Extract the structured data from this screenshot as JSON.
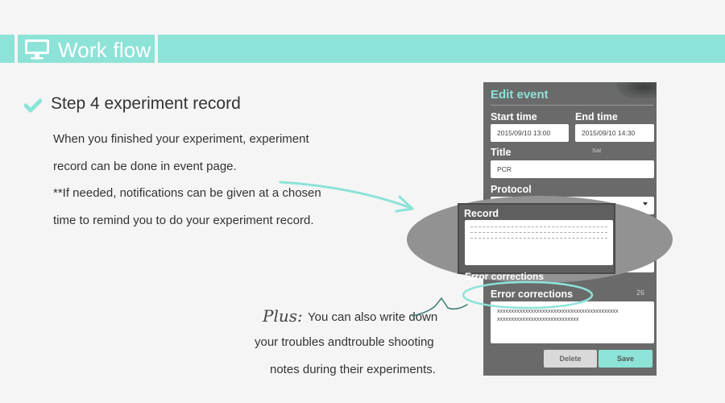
{
  "header": {
    "title": "Work flow",
    "icon": "monitor-icon",
    "color": "#8de3d8"
  },
  "step": {
    "icon": "check-icon",
    "title": "Step  4 experiment record",
    "lines": [
      "When you finished your experiment, experiment",
      "record can be done in event page.",
      "**If needed, notifications can be given at a chosen",
      "time to remind you to do your experiment record."
    ]
  },
  "plus": {
    "label": "Plus:",
    "lines": [
      "You can also write down",
      "your troubles andtrouble shooting",
      "notes during their experiments."
    ]
  },
  "edit_event": {
    "title": "Edit event",
    "start_time_label": "Start time",
    "end_time_label": "End time",
    "start_time_value": "2015/09/10 13:00",
    "end_time_value": "2015/09/10 14:30",
    "day_hint": "Sat",
    "title_label": "Title",
    "title_value": "PCR",
    "protocol_label": "Protocol",
    "record_label": "Record",
    "error_corrections_label": "Error corrections",
    "error_corrections_peek": "Error corrections",
    "count_value": "26",
    "error_text_line1": "xxxxxxxxxxxxxxxxxxxxxxxxxxxxxxxxxxxxxxxxxxx",
    "error_text_line2": "xxxxxxxxxxxxxxxxxxxxxxxxxxxxx",
    "delete_label": "Delete",
    "save_label": "Save"
  }
}
